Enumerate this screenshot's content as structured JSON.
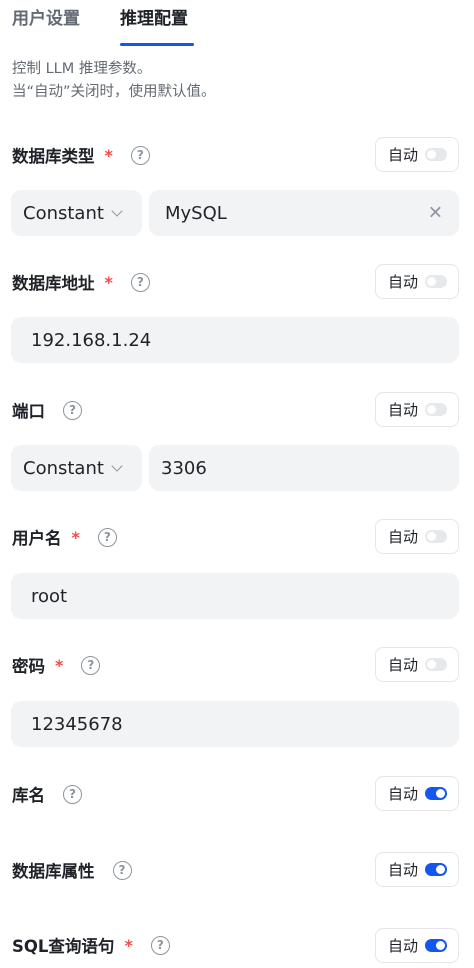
{
  "tabs": {
    "user_settings": "用户设置",
    "inference_config": "推理配置"
  },
  "description": {
    "line1": "控制 LLM 推理参数。",
    "line2": "当“自动”关闭时，使用默认值。"
  },
  "help_glyph": "?",
  "required_mark": "*",
  "fields": {
    "db_type": {
      "label": "数据库类型",
      "required": true,
      "auto_label": "自动",
      "auto_on": false,
      "mode": "Constant",
      "value": "MySQL",
      "clear_glyph": "✕"
    },
    "db_address": {
      "label": "数据库地址",
      "required": true,
      "auto_label": "自动",
      "auto_on": false,
      "value": "192.168.1.24"
    },
    "port": {
      "label": "端口",
      "required": false,
      "auto_label": "自动",
      "auto_on": false,
      "mode": "Constant",
      "value": "3306"
    },
    "username": {
      "label": "用户名",
      "required": true,
      "auto_label": "自动",
      "auto_on": false,
      "value": "root"
    },
    "password": {
      "label": "密码",
      "required": true,
      "auto_label": "自动",
      "auto_on": false,
      "value": "12345678"
    },
    "db_name": {
      "label": "库名",
      "required": false,
      "auto_label": "自动",
      "auto_on": true
    },
    "db_properties": {
      "label": "数据库属性",
      "required": false,
      "auto_label": "自动",
      "auto_on": true
    },
    "sql_query": {
      "label": "SQL查询语句",
      "required": true,
      "auto_label": "自动",
      "auto_on": true
    }
  },
  "colors": {
    "accent": "#1456f0",
    "required": "#f54a45",
    "field_bg": "#f2f3f5",
    "muted": "#646a73"
  }
}
